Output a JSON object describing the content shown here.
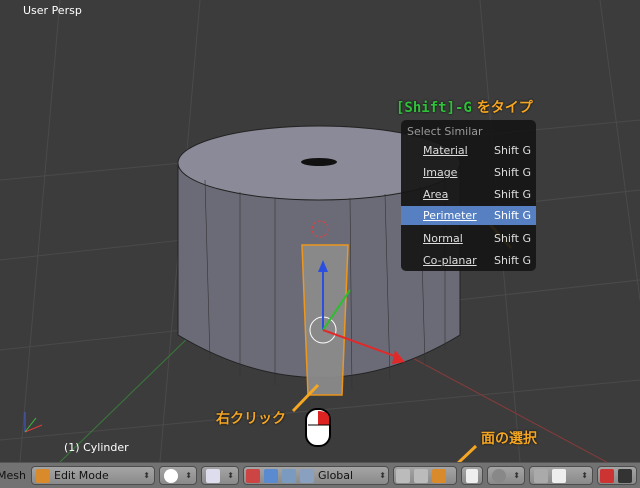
{
  "viewport": {
    "view_name": "User Persp",
    "object_label": "(1) Cylinder"
  },
  "hint": {
    "keys": "[Shift]-G",
    "text": " をタイプ"
  },
  "menu": {
    "title": "Select Similar",
    "items": [
      {
        "label": "Material",
        "shortcut": "Shift G"
      },
      {
        "label": "Image",
        "shortcut": "Shift G"
      },
      {
        "label": "Area",
        "shortcut": "Shift G"
      },
      {
        "label": "Perimeter",
        "shortcut": "Shift G",
        "active": true
      },
      {
        "label": "Normal",
        "shortcut": "Shift G"
      },
      {
        "label": "Co-planar",
        "shortcut": "Shift G"
      }
    ]
  },
  "annotations": {
    "right_click": "右クリック",
    "face_select": "面の選択"
  },
  "header": {
    "menu_label": "Mesh",
    "mode": "Edit Mode",
    "orientation": "Global"
  },
  "colors": {
    "accent": "#f5a623",
    "highlight": "#5680c2",
    "key_text": "#2fc13a"
  }
}
